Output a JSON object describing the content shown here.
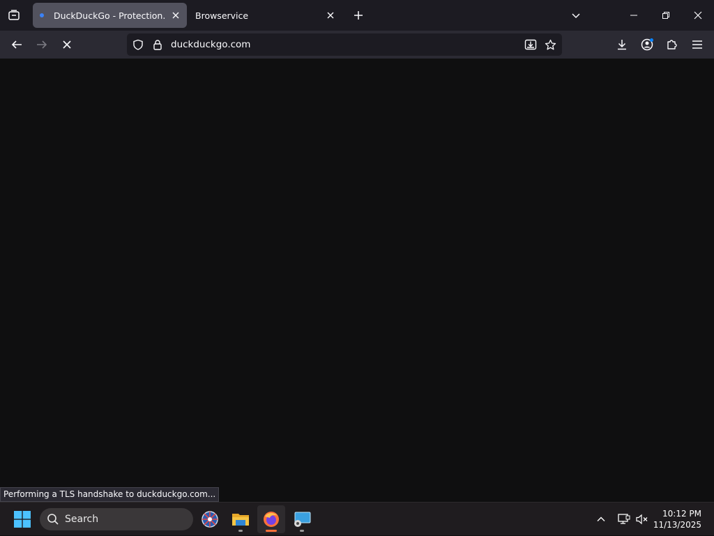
{
  "browser": {
    "tabs": [
      {
        "title": "DuckDuckGo - Protection. Privacy. Peace of mind.",
        "active": true
      },
      {
        "title": "Browservice",
        "active": false
      }
    ],
    "url": "duckduckgo.com",
    "status_text": "Performing a TLS handshake to duckduckgo.com..."
  },
  "taskbar": {
    "search_label": "Search",
    "apps": [
      "network-icon",
      "file-explorer-icon",
      "firefox-icon",
      "remote-desktop-icon"
    ],
    "time": "10:12 PM",
    "date": "11/13/2025"
  },
  "colors": {
    "accent": "#3b82f6",
    "firefox_indicator": "#ff7139",
    "status_dot": "#0a84ff"
  }
}
